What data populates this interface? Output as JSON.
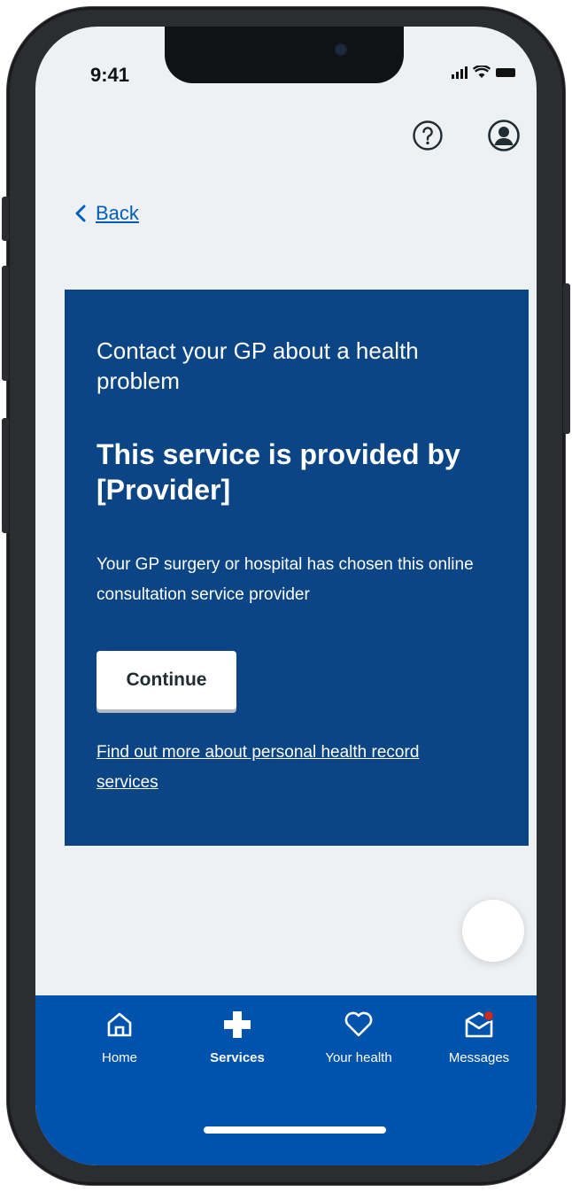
{
  "status_bar": {
    "time": "9:41"
  },
  "header": {
    "help_icon": "help-circle-icon",
    "profile_icon": "user-profile-icon"
  },
  "back": {
    "label": "Back",
    "icon": "chevron-left-icon"
  },
  "card": {
    "caption": "Contact your GP about a health problem",
    "heading": "This service is provided by [Provider]",
    "body": "Your GP surgery or hospital has chosen this online consultation service provider",
    "button_label": "Continue",
    "link_text": "Find out more about personal health record services"
  },
  "bottom_nav": {
    "items": [
      {
        "label": "Home",
        "icon": "home-icon",
        "active": false
      },
      {
        "label": "Services",
        "icon": "plus-cross-icon",
        "active": true
      },
      {
        "label": "Your health",
        "icon": "heart-icon",
        "active": false
      },
      {
        "label": "Messages",
        "icon": "envelope-notification-icon",
        "active": false
      }
    ]
  },
  "colors": {
    "card_background": "#0c4585",
    "nav_background": "#0053ad",
    "link_blue": "#005eb8",
    "screen_background": "#eef1f4",
    "notification_dot": "#d5281b"
  }
}
